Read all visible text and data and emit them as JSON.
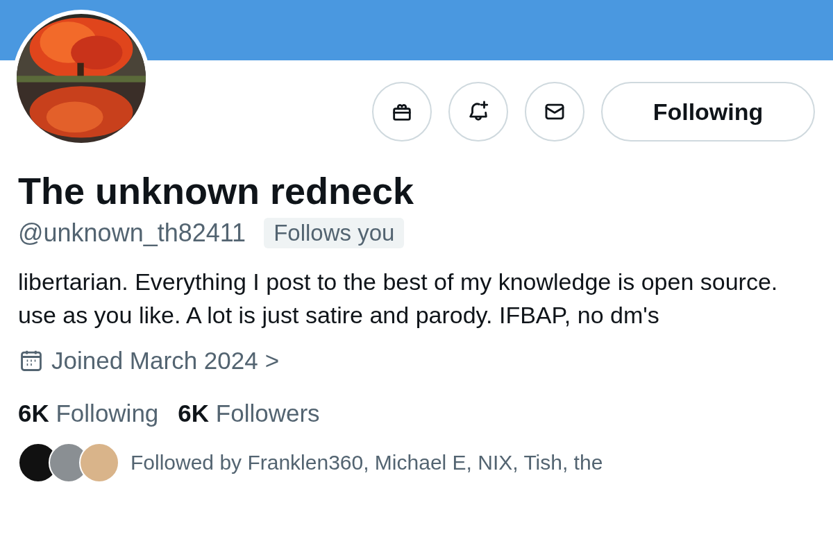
{
  "actions": [
    {
      "kind": "gift"
    },
    {
      "kind": "notify"
    },
    {
      "kind": "message"
    }
  ],
  "follow_button": {
    "label": "Following"
  },
  "profile": {
    "name": "The unknown redneck",
    "handle": "@unknown_th82411",
    "follows_you_badge": "Follows you",
    "bio": "libertarian. Everything I post to the best of my knowledge is open source. use as you like. A lot is just satire and parody. IFBAP, no dm's",
    "joined": "Joined March 2024",
    "chevron": ">"
  },
  "stats": [
    {
      "count": "6K",
      "label": "Following"
    },
    {
      "count": "6K",
      "label": "Followers"
    }
  ],
  "followed_by": {
    "avatars": [
      {
        "color": "#111111"
      },
      {
        "color": "#8a8f93"
      },
      {
        "color": "#d9b48a"
      }
    ],
    "text": "Followed by Franklen360, Michael E, NIX, Tish, the"
  }
}
